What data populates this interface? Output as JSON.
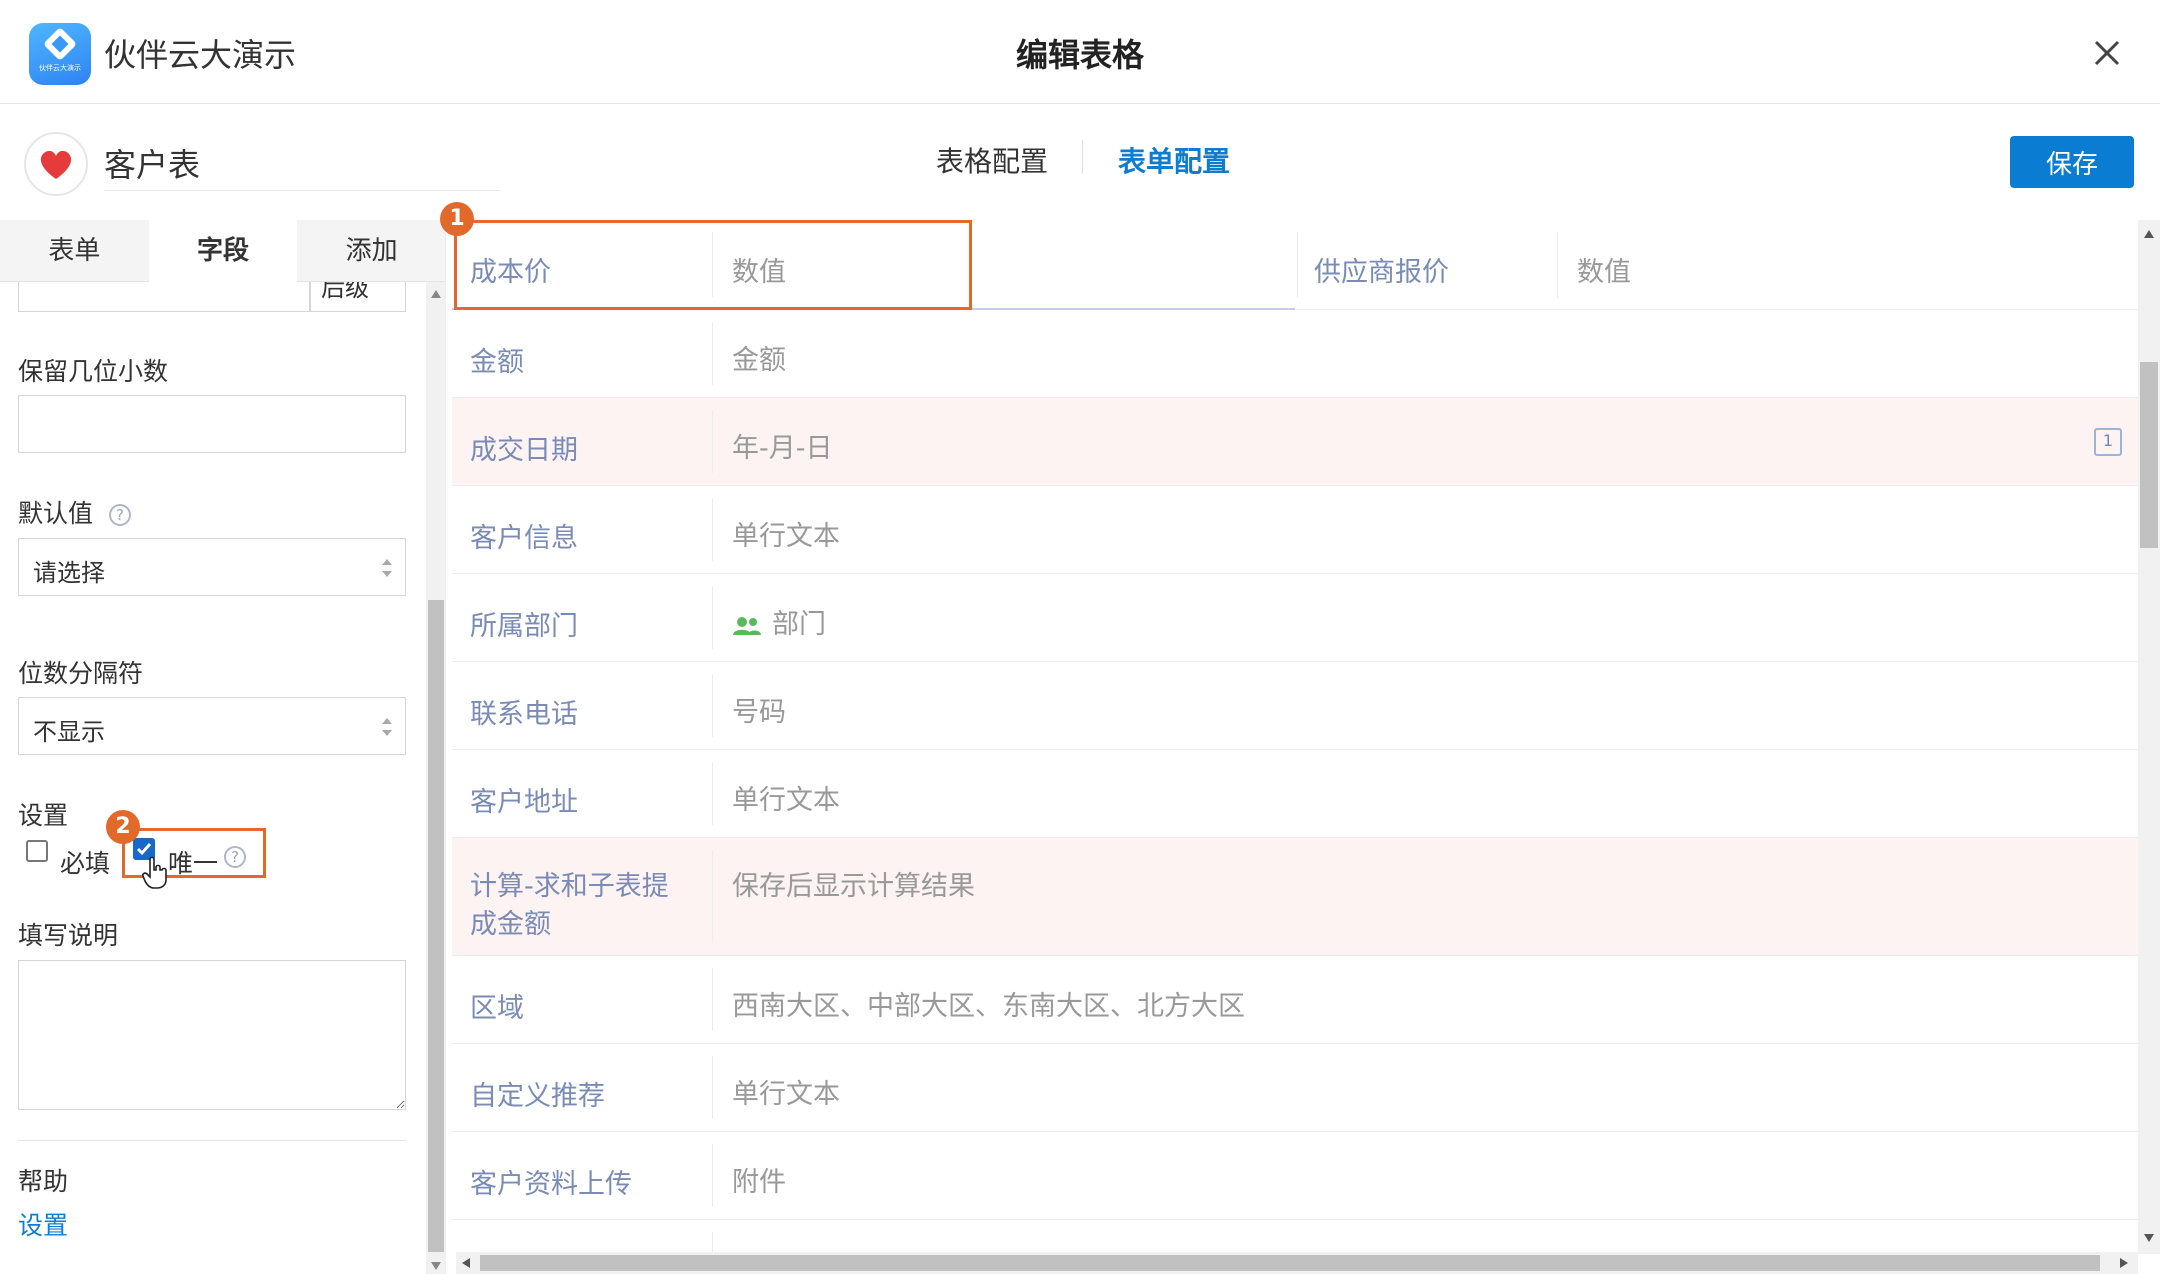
{
  "app": {
    "name": "伙伴云大演示",
    "logo_text": "伙伴云大演示"
  },
  "dialog": {
    "title": "编辑表格"
  },
  "header": {
    "form_name": "客户表",
    "tabs": [
      {
        "label": "表格配置"
      },
      {
        "label": "表单配置"
      }
    ],
    "active_tab": "表单配置",
    "save_label": "保存"
  },
  "left_panel": {
    "tabs": [
      {
        "label": "表单"
      },
      {
        "label": "字段"
      },
      {
        "label": "添加"
      }
    ],
    "active_tab": "字段",
    "partial_select_value": "后级",
    "decimal_label": "保留几位小数",
    "decimal_value": "",
    "default_label": "默认值",
    "default_select": "请选择",
    "separator_label": "位数分隔符",
    "separator_select": "不显示",
    "settings_label": "设置",
    "required_label": "必填",
    "required_checked": false,
    "unique_label": "唯一",
    "unique_checked": true,
    "description_label": "填写说明",
    "description_value": "",
    "help_label": "帮助",
    "help_link": "设置",
    "annotation_badge": "2"
  },
  "form_grid": {
    "annotation_badge": "1",
    "top_row": [
      {
        "label": "成本价",
        "placeholder": "数值"
      },
      {
        "label": "供应商报价",
        "placeholder": "数值"
      }
    ],
    "rows": [
      {
        "label": "金额",
        "placeholder": "金额",
        "highlight": false
      },
      {
        "label": "成交日期",
        "placeholder": "年-月-日",
        "highlight": true,
        "icon": "calendar-icon"
      },
      {
        "label": "客户信息",
        "placeholder": "单行文本",
        "highlight": false
      },
      {
        "label": "所属部门",
        "placeholder": "部门",
        "highlight": false,
        "icon": "department-icon"
      },
      {
        "label": "联系电话",
        "placeholder": "号码",
        "highlight": false
      },
      {
        "label": "客户地址",
        "placeholder": "单行文本",
        "highlight": false
      },
      {
        "label": "计算-求和子表提成金额",
        "label_line1": "计算-求和子表提",
        "label_line2": "成金额",
        "placeholder": "保存后显示计算结果",
        "highlight": true
      },
      {
        "label": "区域",
        "placeholder": "西南大区、中部大区、东南大区、北方大区",
        "highlight": false
      },
      {
        "label": "自定义推荐",
        "placeholder": "单行文本",
        "highlight": false
      },
      {
        "label": "客户资料上传",
        "placeholder": "附件",
        "highlight": false
      }
    ]
  },
  "colors": {
    "accent": "#0a7cd1",
    "label": "#7a8bb5",
    "highlight_row": "#fdf3f3",
    "annotation": "#e2692a",
    "heart": "#e53b3b",
    "department_icon": "#5cb85c"
  }
}
